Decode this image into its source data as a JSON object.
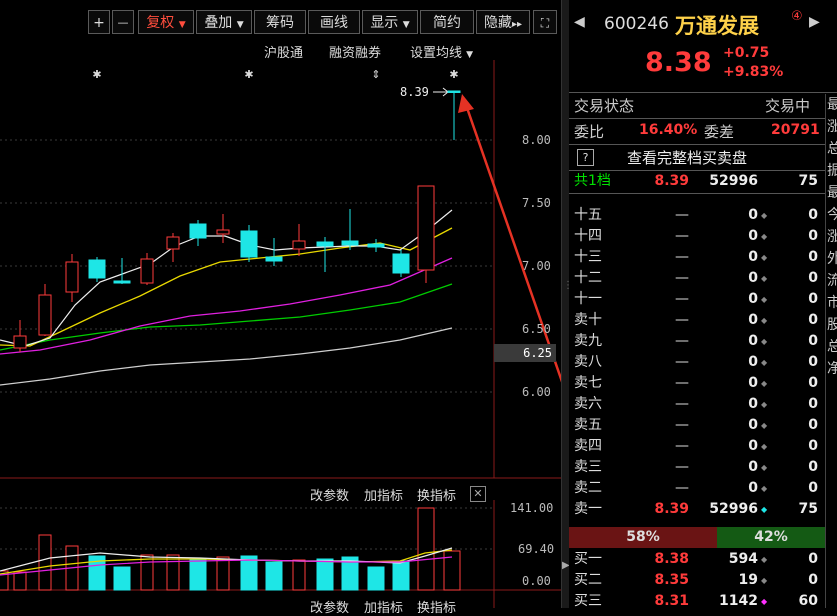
{
  "toolbar": {
    "plus": "+",
    "minus": "—",
    "fuquan": "复权",
    "diejia": "叠加",
    "chouma": "筹码",
    "huaxian": "画线",
    "xianshi": "显示",
    "jianyue": "简约",
    "yincang": "隐藏"
  },
  "chart_menu": {
    "hugutong": "沪股通",
    "rongzi": "融资融券",
    "set_ma": "设置均线"
  },
  "main_chart": {
    "price_label": "8.39",
    "axis_ticks": [
      "8.00",
      "7.50",
      "7.00",
      "6.50",
      "6.00"
    ],
    "current_price_tag": "6.25"
  },
  "indicator": {
    "gai": "改参数",
    "jia": "加指标",
    "huan": "换指标",
    "axis_ticks": [
      "141.00",
      "69.40",
      "0.00"
    ]
  },
  "stock": {
    "code": "600246",
    "name": "万通发展",
    "badge": "④",
    "price": "8.38",
    "change": "+0.75",
    "change_pct": "+9.83%"
  },
  "panel": {
    "status_label": "交易状态",
    "status_value": "交易中",
    "webi_label": "委比",
    "webi_value": "16.40%",
    "weicha_label": "委差",
    "weicha_value": "20791",
    "help_glyph": "?",
    "full_book": "查看完整档买卖盘",
    "total_label": "共1档",
    "total_price": "8.39",
    "total_vol": "52996",
    "total_ch": "75",
    "sell_rows": [
      {
        "name": "十五",
        "price": "—",
        "vol": "0",
        "ch": "0"
      },
      {
        "name": "十四",
        "price": "—",
        "vol": "0",
        "ch": "0"
      },
      {
        "name": "十三",
        "price": "—",
        "vol": "0",
        "ch": "0"
      },
      {
        "name": "十二",
        "price": "—",
        "vol": "0",
        "ch": "0"
      },
      {
        "name": "十一",
        "price": "—",
        "vol": "0",
        "ch": "0"
      },
      {
        "name": "卖十",
        "price": "—",
        "vol": "0",
        "ch": "0"
      },
      {
        "name": "卖九",
        "price": "—",
        "vol": "0",
        "ch": "0"
      },
      {
        "name": "卖八",
        "price": "—",
        "vol": "0",
        "ch": "0"
      },
      {
        "name": "卖七",
        "price": "—",
        "vol": "0",
        "ch": "0"
      },
      {
        "name": "卖六",
        "price": "—",
        "vol": "0",
        "ch": "0"
      },
      {
        "name": "卖五",
        "price": "—",
        "vol": "0",
        "ch": "0"
      },
      {
        "name": "卖四",
        "price": "—",
        "vol": "0",
        "ch": "0"
      },
      {
        "name": "卖三",
        "price": "—",
        "vol": "0",
        "ch": "0"
      },
      {
        "name": "卖二",
        "price": "—",
        "vol": "0",
        "ch": "0"
      },
      {
        "name": "卖一",
        "price": "8.39",
        "vol": "52996",
        "ch": "75"
      }
    ],
    "ratio_left": "58%",
    "ratio_right": "42%",
    "buy_rows": [
      {
        "name": "买一",
        "price": "8.38",
        "vol": "594",
        "ch": "0"
      },
      {
        "name": "买二",
        "price": "8.35",
        "vol": "19",
        "ch": "0"
      },
      {
        "name": "买三",
        "price": "8.31",
        "vol": "1142",
        "ch": "60"
      }
    ],
    "side_chars": [
      "最",
      "涨",
      "总",
      "振",
      "最",
      "今",
      "涨",
      "外",
      "流",
      "市",
      "股",
      "总",
      "净"
    ]
  },
  "colors": {
    "red": "#ff3b3b",
    "cyan": "#1ee6e6",
    "yellow": "#f0e000",
    "green": "#00e000",
    "magenta": "#ff30ff"
  }
}
